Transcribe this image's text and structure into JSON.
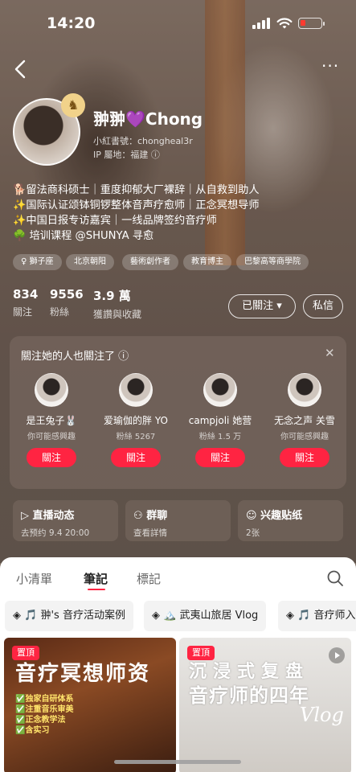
{
  "status_bar": {
    "time": "14:20"
  },
  "profile": {
    "name": "翀翀💜Chong",
    "handle": "小紅書號：chongheal3r",
    "ip": "IP 屬地：福建",
    "bio": [
      "🐕留法商科硕士｜重度抑郁大厂裸辞｜从自救到助人",
      "✨国际认证颂钵铜锣整体音声疗愈师｜正念冥想导师",
      "✨中国日报专访嘉宾｜一线品牌签约音疗师",
      "🌳 培训课程 @SHUNYA 寻愈"
    ],
    "tags": [
      "♀ 獅子座",
      "北京朝阳",
      "藝術創作者",
      "教育博主",
      "巴黎高等商學院"
    ],
    "stats": [
      {
        "value": "834",
        "label": "關注"
      },
      {
        "value": "9556",
        "label": "粉絲"
      },
      {
        "value": "3.9 萬",
        "label": "獲讚與收藏"
      }
    ],
    "follow_label": "已關注 ▾",
    "message_label": "私信"
  },
  "recommend": {
    "title": "關注她的人也關注了 ⓘ",
    "close": "✕",
    "users": [
      {
        "name": "是王兔子🐰",
        "sub": "你可能感興趣",
        "button": "關注"
      },
      {
        "name": "爱瑜伽的胖 YO",
        "sub": "粉絲 5267",
        "button": "關注"
      },
      {
        "name": "campjoli 她营",
        "sub": "粉絲 1.5 万",
        "button": "關注"
      },
      {
        "name": "无念之声 关雪",
        "sub": "你可能感興趣",
        "button": "關注"
      }
    ]
  },
  "cards": [
    {
      "title": "直播动态",
      "sub": "去预约 9.4 20:00",
      "icon": "play-icon"
    },
    {
      "title": "群聊",
      "sub": "查看詳情",
      "icon": "group-icon"
    },
    {
      "title": "兴趣贴纸",
      "sub": "2张",
      "icon": "sticker-icon"
    }
  ],
  "tabs": [
    "小清單",
    "筆記",
    "標記"
  ],
  "collections": [
    "🎵 翀's 音疗活动案例",
    "🏔️ 武夷山旅居 Vlog",
    "🎵 音疗师入"
  ],
  "posts": [
    {
      "pin": "置頂",
      "title": "音疗冥想师资",
      "lines": [
        "✅独家自研体系",
        "✅注重音乐审美",
        "✅正念教学法",
        "✅含实习"
      ]
    },
    {
      "pin": "置頂",
      "title1": "沉浸式复盘",
      "title2": "音疗师的四年",
      "vlog": "Vlog"
    }
  ],
  "colors": {
    "accent": "#ff2442"
  }
}
